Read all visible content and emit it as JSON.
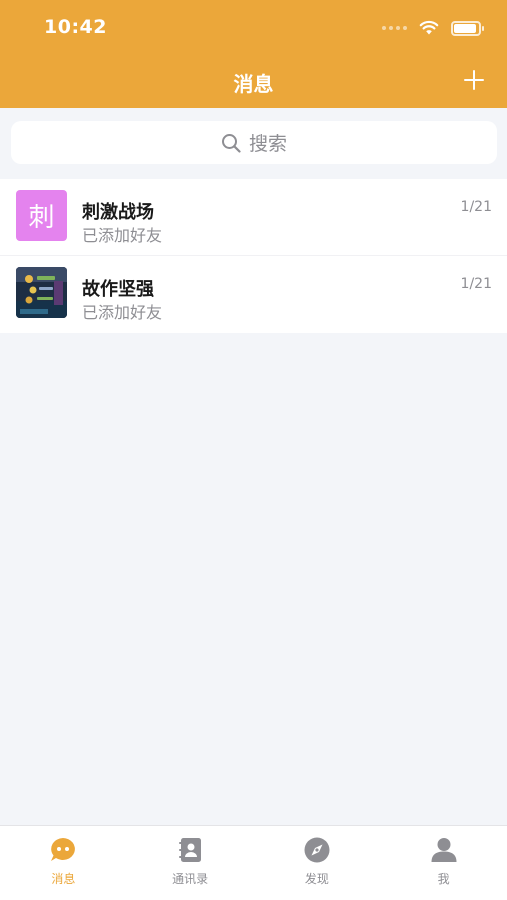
{
  "status_bar": {
    "time": "10:42",
    "battery_level": 0.85
  },
  "header": {
    "title": "消息",
    "add_icon": "plus-icon"
  },
  "search": {
    "placeholder": "搜索",
    "icon": "search-icon"
  },
  "chats": [
    {
      "avatar_text": "刺",
      "avatar_color": "#e483ee",
      "name": "刺激战场",
      "subtitle": "已添加好友",
      "date": "1/21"
    },
    {
      "avatar_image": "game-screenshot",
      "name": "故作坚强",
      "subtitle": "已添加好友",
      "date": "1/21"
    }
  ],
  "tabbar": {
    "active_color": "#eba73a",
    "inactive_color": "#8e8e93",
    "items": [
      {
        "label": "消息",
        "icon": "chat-bubble-icon",
        "active": true
      },
      {
        "label": "通讯录",
        "icon": "contacts-book-icon",
        "active": false
      },
      {
        "label": "发现",
        "icon": "compass-icon",
        "active": false
      },
      {
        "label": "我",
        "icon": "person-icon",
        "active": false
      }
    ]
  }
}
